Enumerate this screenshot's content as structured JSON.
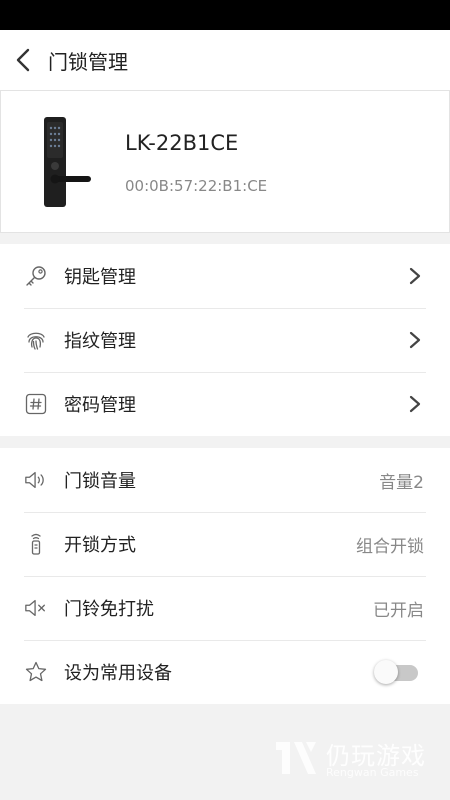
{
  "header": {
    "title": "门锁管理"
  },
  "device": {
    "name": "LK-22B1CE",
    "mac": "00:0B:57:22:B1:CE"
  },
  "section1": {
    "items": [
      {
        "label": "钥匙管理",
        "icon": "key-icon"
      },
      {
        "label": "指纹管理",
        "icon": "fingerprint-icon"
      },
      {
        "label": "密码管理",
        "icon": "hash-icon"
      }
    ]
  },
  "section2": {
    "items": [
      {
        "label": "门锁音量",
        "value": "音量2",
        "icon": "volume-icon"
      },
      {
        "label": "开锁方式",
        "value": "组合开锁",
        "icon": "remote-icon"
      },
      {
        "label": "门铃免打扰",
        "value": "已开启",
        "icon": "mute-icon"
      },
      {
        "label": "设为常用设备",
        "icon": "star-icon",
        "toggle_on": false
      }
    ]
  },
  "watermark": {
    "brand_cn": "仍玩游戏",
    "brand_en": "Rengwan Games"
  },
  "colors": {
    "background": "#f2f2f2",
    "card": "#ffffff",
    "text": "#222222",
    "secondary_text": "#888888",
    "toggle_off": "#c8c8c8"
  }
}
